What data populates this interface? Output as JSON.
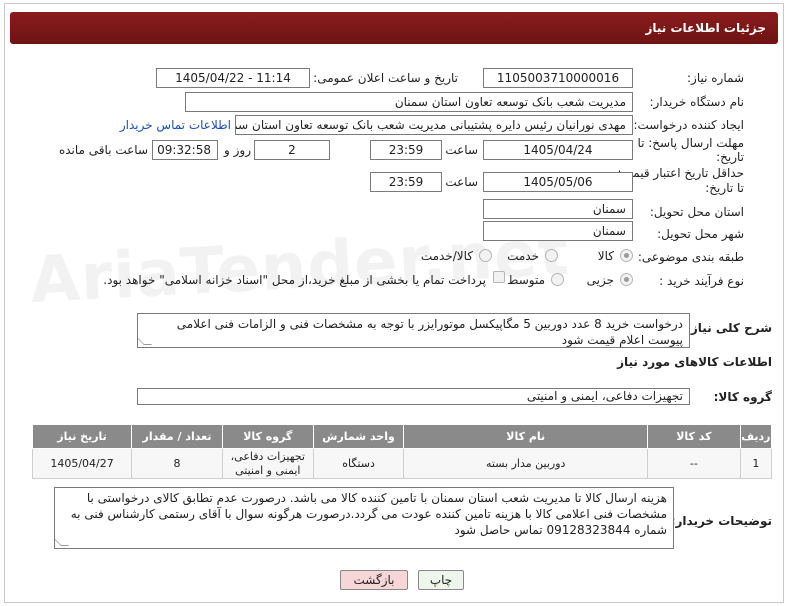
{
  "header": {
    "title": "جزئیات اطلاعات نیاز"
  },
  "fields": {
    "need_number": {
      "label": "شماره نیاز:",
      "value": "1105003710000016"
    },
    "announce": {
      "label": "تاریخ و ساعت اعلان عمومی:",
      "value": "1405/04/22 - 11:14"
    },
    "buyer_org": {
      "label": "نام دستگاه خریدار:",
      "value": "مدیریت شعب بانک توسعه تعاون استان سمنان"
    },
    "requester": {
      "label": "ایجاد کننده درخواست:",
      "value": "مهدی نورانیان رئیس دایره پشتیبانی مدیریت شعب بانک توسعه تعاون استان سمنان",
      "contact_link": "اطلاعات تماس خریدار"
    },
    "reply_deadline": {
      "label_line1": "مهلت ارسال پاسخ: تا",
      "label_line2": "تاریخ:",
      "date": "1405/04/24",
      "time_label": "ساعت",
      "time": "23:59",
      "days": "2",
      "days_label": "روز و",
      "remaining": "09:32:58",
      "remaining_label": "ساعت باقی مانده"
    },
    "price_validity": {
      "label_line1": "حداقل تاریخ اعتبار قیمت:",
      "label_line2": "تا تاریخ:",
      "date": "1405/05/06",
      "time_label": "ساعت",
      "time": "23:59"
    },
    "delivery_province": {
      "label": "استان محل تحویل:",
      "value": "سمنان"
    },
    "delivery_city": {
      "label": "شهر محل تحویل:",
      "value": "سمنان"
    },
    "category": {
      "label": "طبقه بندی موضوعی:",
      "options": [
        "کالا",
        "خدمت",
        "کالا/خدمت"
      ],
      "selected": "کالا"
    },
    "purchase_type": {
      "label": "نوع فرآیند خرید :",
      "options": [
        "جزیی",
        "متوسط"
      ],
      "selected": "جزیی",
      "note": "پرداخت تمام یا بخشی از مبلغ خرید،از محل \"اسناد خزانه اسلامی\" خواهد بود."
    }
  },
  "general_desc": {
    "label": "شرح کلی نیاز:",
    "value": "درخواست خرید 8 عدد دوربین 5 مگاپیکسل موتورایزر با توجه به مشخصات فنی و الزامات فنی اعلامی پیوست اعلام قیمت شود"
  },
  "goods_info": {
    "title": "اطلاعات کالاهای مورد نیاز"
  },
  "goods_group": {
    "label": "گروه کالا:",
    "value": "تجهیزات دفاعی، ایمنی و امنیتی"
  },
  "table": {
    "headers": [
      "ردیف",
      "کد کالا",
      "نام کالا",
      "واحد شمارش",
      "گروه کالا",
      "تعداد / مقدار",
      "تاریخ نیاز"
    ],
    "rows": [
      [
        "1",
        "--",
        "دوربین مدار بسته",
        "دستگاه",
        "تجهیزات دفاعی، ایمنی و امنیتی",
        "8",
        "1405/04/27"
      ]
    ]
  },
  "buyer_notes": {
    "label": "توضیحات خریدار:",
    "value": "هزینه ارسال  کالا تا مدیریت شعب استان سمنان با تامین کننده کالا می باشد. درصورت عدم تطابق کالای درخواستی با مشخصات فنی اعلامی کالا با هزینه تامین کننده عودت می گردد.درصورت هرگونه سوال با آقای رستمی کارشناس فنی به شماره 09128323844 تماس حاصل شود"
  },
  "buttons": {
    "print": "چاپ",
    "back": "بازگشت"
  },
  "watermark": "AriaTender.net"
}
